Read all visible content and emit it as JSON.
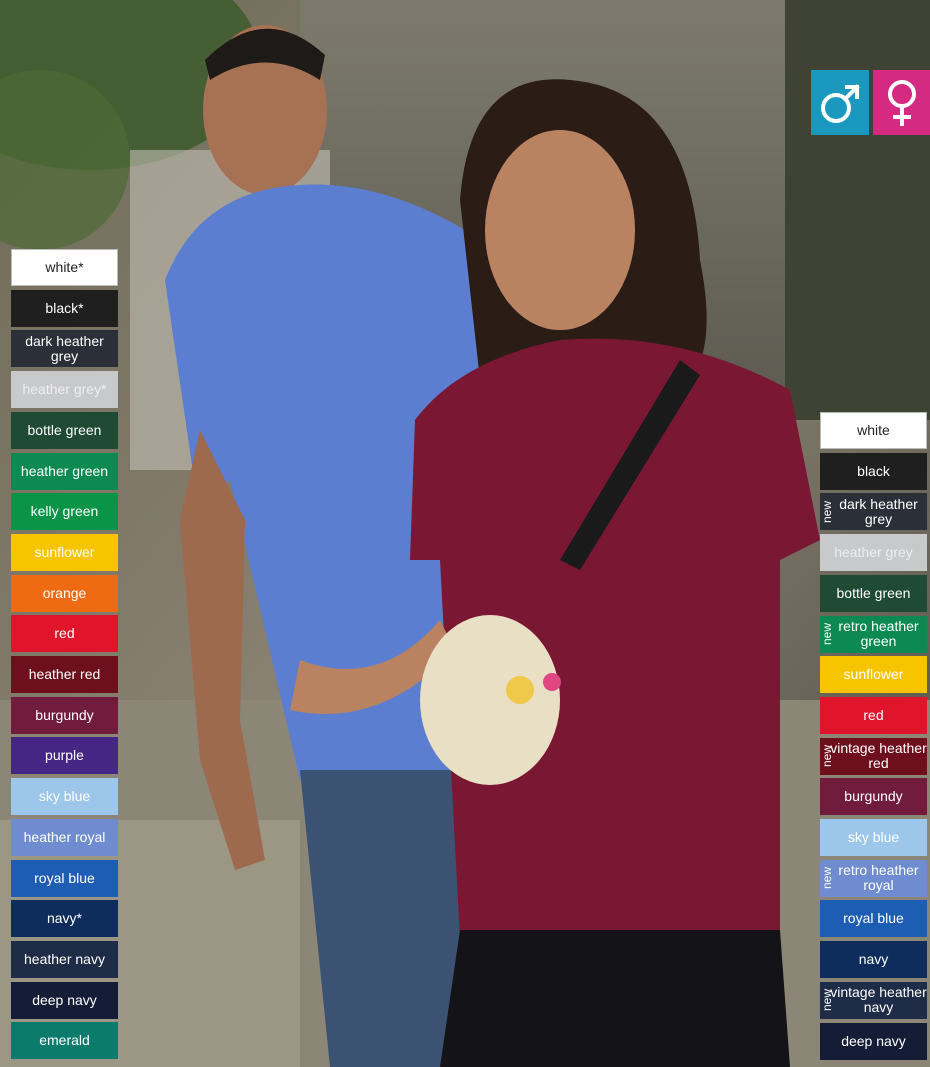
{
  "gender": {
    "male": {
      "symbol": "♂",
      "color": "#1a98bd"
    },
    "female": {
      "symbol": "♀",
      "color": "#d42a82"
    }
  },
  "left_colors": [
    {
      "label": "white*",
      "color": "#ffffff",
      "dark_text": true
    },
    {
      "label": "black*",
      "color": "#1f1f1f"
    },
    {
      "label": "dark heather grey",
      "color": "#2b3038"
    },
    {
      "label": "heather grey*",
      "color": "#c8c9cb"
    },
    {
      "label": "bottle green",
      "color": "#1f4a33"
    },
    {
      "label": "heather green",
      "color": "#0d8a52"
    },
    {
      "label": "kelly green",
      "color": "#0a9447"
    },
    {
      "label": "sunflower",
      "color": "#f7c400"
    },
    {
      "label": "orange",
      "color": "#ee6a13"
    },
    {
      "label": "red",
      "color": "#e0142a"
    },
    {
      "label": "heather red",
      "color": "#6e0f1d"
    },
    {
      "label": "burgundy",
      "color": "#721c3d"
    },
    {
      "label": "purple",
      "color": "#462684"
    },
    {
      "label": "sky blue",
      "color": "#9cc7ea"
    },
    {
      "label": "heather royal",
      "color": "#6e8ccf"
    },
    {
      "label": "royal blue",
      "color": "#1d5eb4"
    },
    {
      "label": "navy*",
      "color": "#0f2d5c"
    },
    {
      "label": "heather navy",
      "color": "#1f2c47"
    },
    {
      "label": "deep navy",
      "color": "#141d35"
    },
    {
      "label": "emerald",
      "color": "#0b7c6b"
    }
  ],
  "right_colors": [
    {
      "label": "white",
      "color": "#ffffff",
      "dark_text": true
    },
    {
      "label": "black",
      "color": "#1f1f1f"
    },
    {
      "label": "dark heather grey",
      "color": "#2b3038",
      "new": true
    },
    {
      "label": "heather grey",
      "color": "#c8c9cb"
    },
    {
      "label": "bottle green",
      "color": "#1f4a33"
    },
    {
      "label": "retro heather green",
      "color": "#0d8a52",
      "new": true
    },
    {
      "label": "sunflower",
      "color": "#f7c400"
    },
    {
      "label": "red",
      "color": "#e0142a"
    },
    {
      "label": "vintage heather red",
      "color": "#6e0f1d",
      "new": true
    },
    {
      "label": "burgundy",
      "color": "#721c3d"
    },
    {
      "label": "sky blue",
      "color": "#9cc7ea"
    },
    {
      "label": "retro heather royal",
      "color": "#6e8ccf",
      "new": true
    },
    {
      "label": "royal blue",
      "color": "#1d5eb4"
    },
    {
      "label": "navy",
      "color": "#0f2d5c"
    },
    {
      "label": "vintage heather navy",
      "color": "#1f2c47",
      "new": true
    },
    {
      "label": "deep navy",
      "color": "#141d35"
    }
  ],
  "new_label": "new"
}
